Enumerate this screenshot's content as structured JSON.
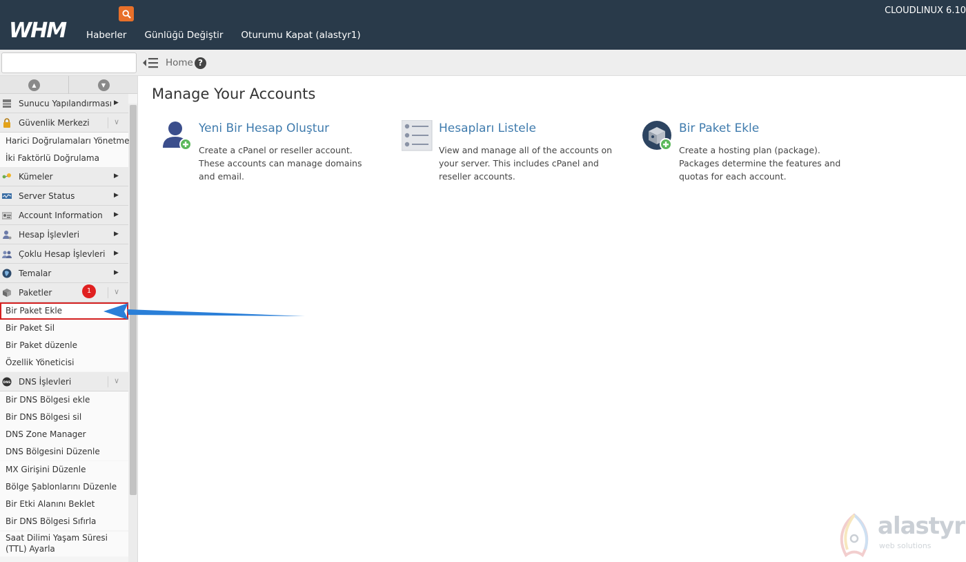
{
  "header": {
    "logo_text": "WHM",
    "nav": [
      "Haberler",
      "Günlüğü Değiştir",
      "Oturumu Kapat (alastyr1)"
    ],
    "version": "CLOUDLINUX 6.10"
  },
  "toolbar": {
    "search_value": "",
    "breadcrumb": "Home",
    "help_symbol": "?"
  },
  "sidebar": {
    "categories": [
      {
        "label": "Sunucu Yapılandırması",
        "icon": "server-config-icon",
        "state": "collapsed"
      },
      {
        "label": "Güvenlik Merkezi",
        "icon": "lock-icon",
        "state": "expanded"
      },
      {
        "label": "Kümeler",
        "icon": "cluster-icon",
        "state": "collapsed"
      },
      {
        "label": "Server Status",
        "icon": "monitor-icon",
        "state": "collapsed"
      },
      {
        "label": "Account Information",
        "icon": "account-info-icon",
        "state": "collapsed"
      },
      {
        "label": "Hesap İşlevleri",
        "icon": "user-gear-icon",
        "state": "collapsed"
      },
      {
        "label": "Çoklu Hesap İşlevleri",
        "icon": "users-icon",
        "state": "collapsed"
      },
      {
        "label": "Temalar",
        "icon": "theme-globe-icon",
        "state": "collapsed"
      },
      {
        "label": "Paketler",
        "icon": "package-box-icon",
        "state": "expanded"
      },
      {
        "label": "DNS İşlevleri",
        "icon": "dns-icon",
        "state": "expanded"
      }
    ],
    "security_items": [
      "Harici Doğrulamaları Yönetme",
      "İki Faktörlü Doğrulama"
    ],
    "package_items": [
      "Bir Paket Ekle",
      "Bir Paket Sil",
      "Bir Paket düzenle",
      "Özellik Yöneticisi"
    ],
    "dns_items": [
      "Bir DNS Bölgesi ekle",
      "Bir DNS Bölgesi sil",
      "DNS Zone Manager",
      "DNS Bölgesini Düzenle",
      "MX Girişini Düzenle",
      "Bölge Şablonlarını Düzenle",
      "Bir Etki Alanını Beklet",
      "Bir DNS Bölgesi Sıfırla",
      "Saat Dilimi Yaşam Süresi (TTL) Ayarla"
    ],
    "annotation_badge": "1"
  },
  "main": {
    "title": "Manage Your Accounts",
    "cards": [
      {
        "title": "Yeni Bir Hesap Oluştur",
        "description": "Create a cPanel or reseller account. These accounts can manage domains and email.",
        "icon": "add-user-icon"
      },
      {
        "title": "Hesapları Listele",
        "description": "View and manage all of the accounts on your server. This includes cPanel and reseller accounts.",
        "icon": "account-list-icon"
      },
      {
        "title": "Bir Paket Ekle",
        "description": "Create a hosting plan (package). Packages determine the features and quotas for each account.",
        "icon": "add-package-icon"
      }
    ]
  },
  "watermark": {
    "name": "alastyr",
    "tagline": "web solutions"
  },
  "colors": {
    "header_bg": "#293a4a",
    "link": "#3f7bad",
    "search_button": "#e8702a",
    "highlight_border": "#d42020",
    "arrow": "#2a7fd8"
  }
}
